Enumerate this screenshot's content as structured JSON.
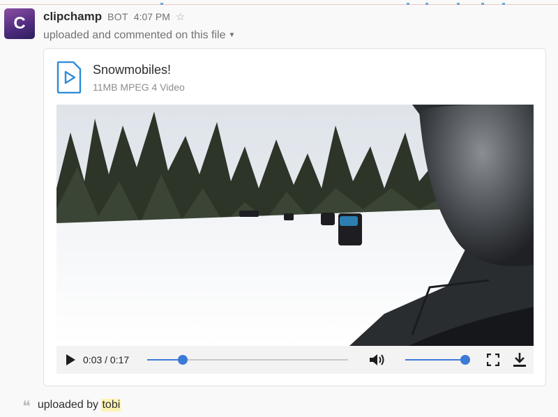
{
  "message": {
    "avatar_letter": "C",
    "sender": "clipchamp",
    "bot_label": "BOT",
    "time": "4:07 PM",
    "action": "uploaded and commented on this file"
  },
  "file": {
    "title": "Snowmobiles!",
    "subtitle": "11MB MPEG 4 Video",
    "icon": "video-file-icon"
  },
  "player": {
    "current_time": "0:03",
    "separator": "/",
    "duration": "0:17",
    "progress": 0.176,
    "volume": 1.0
  },
  "footer": {
    "prefix": "uploaded by",
    "user": "tobi"
  },
  "colors": {
    "accent": "#3c7ad8",
    "mention_bg": "#fdf3b2",
    "avatar": "#6b3a8e"
  }
}
